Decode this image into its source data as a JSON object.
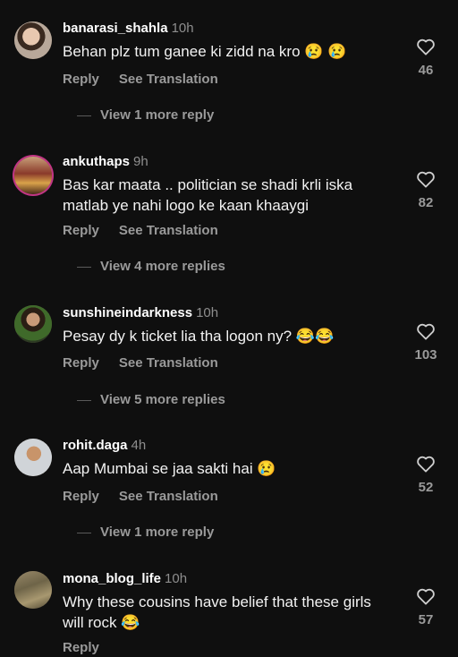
{
  "comments": [
    {
      "username": "banarasi_shahla",
      "time": "10h",
      "text": "Behan plz tum ganee ki zidd na kro 😢 😢",
      "reply": "Reply",
      "translate": "See Translation",
      "likes": "46",
      "more_replies": "View 1 more reply"
    },
    {
      "username": "ankuthaps",
      "time": "9h",
      "text": "Bas kar maata .. politician se shadi krli iska matlab ye nahi logo ke kaan khaaygi",
      "reply": "Reply",
      "translate": "See Translation",
      "likes": "82",
      "more_replies": "View 4 more replies"
    },
    {
      "username": "sunshineindarkness",
      "time": "10h",
      "text": "Pesay dy k ticket lia tha logon ny? 😂😂",
      "reply": "Reply",
      "translate": "See Translation",
      "likes": "103",
      "more_replies": "View 5 more replies"
    },
    {
      "username": "rohit.daga",
      "time": "4h",
      "text": "Aap Mumbai se jaa sakti hai 😢",
      "reply": "Reply",
      "translate": "See Translation",
      "likes": "52",
      "more_replies": "View 1 more reply"
    },
    {
      "username": "mona_blog_life",
      "time": "10h",
      "text": "Why these cousins have belief that these girls will rock 😂",
      "reply": "Reply",
      "likes": "57"
    }
  ],
  "icons": {
    "like": "heart-outline-icon"
  }
}
